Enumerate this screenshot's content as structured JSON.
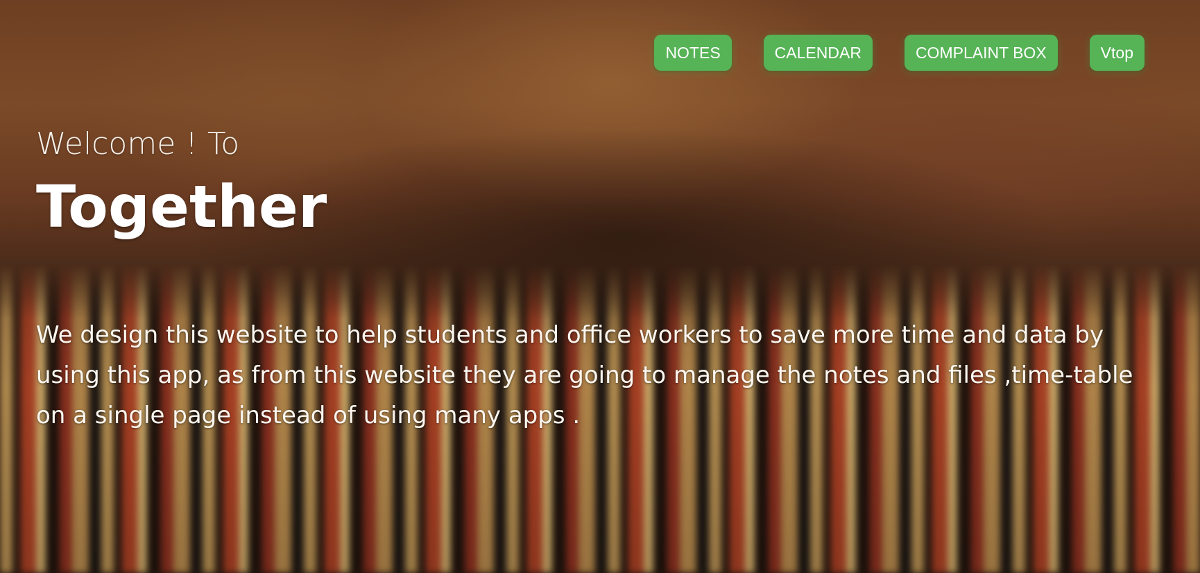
{
  "nav": {
    "items": [
      {
        "label": "NOTES"
      },
      {
        "label": "CALENDAR"
      },
      {
        "label": "COMPLAINT BOX"
      },
      {
        "label": "Vtop"
      }
    ],
    "button_color": "#56b356"
  },
  "hero": {
    "greeting": "Welcome ! To",
    "brand": "Together",
    "description": "We design this website to help students and office workers to save more time and data by using this app, as from this website they are going to manage the notes and files ,time-table on a single page instead of using many apps ."
  },
  "background": {
    "image": "blurred-bookshelf-photo"
  }
}
